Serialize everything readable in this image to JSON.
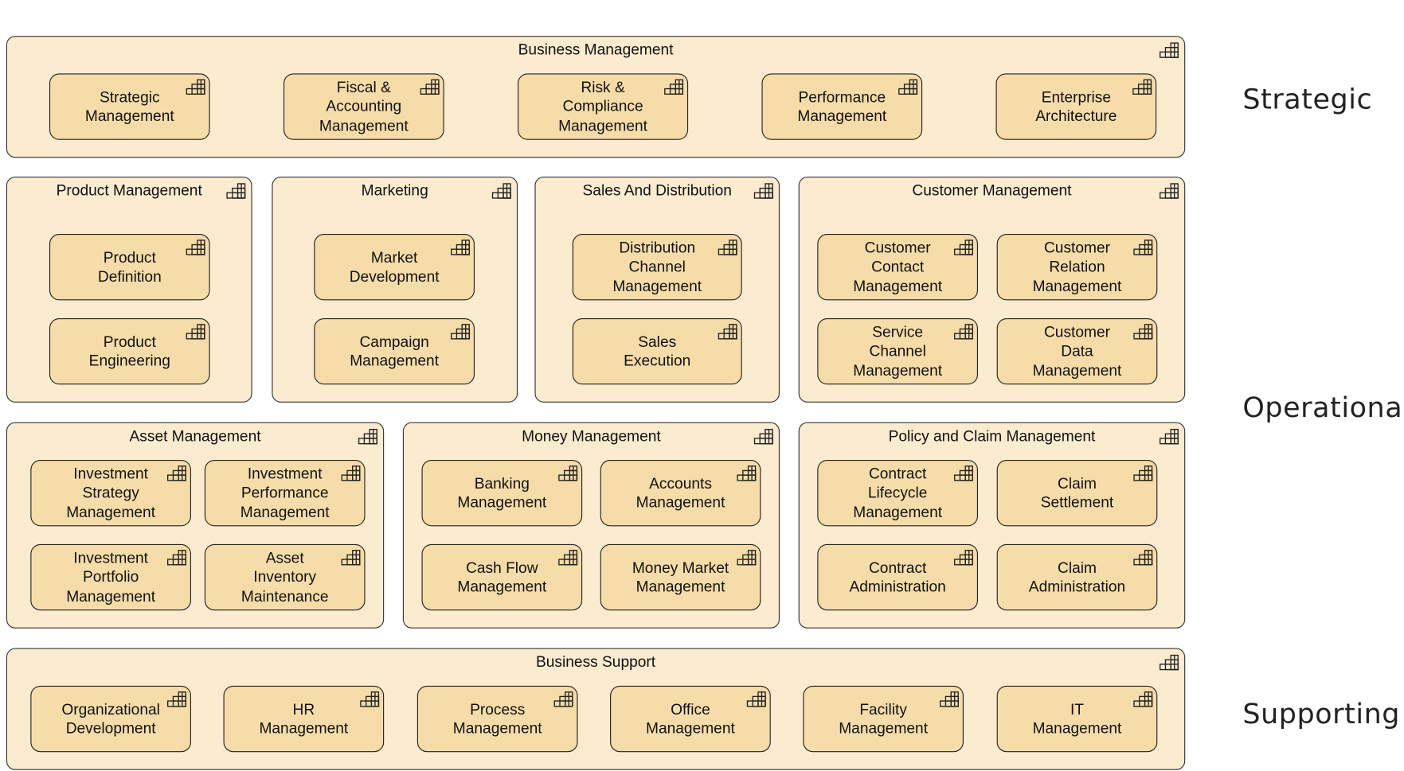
{
  "colors": {
    "group_fill": "#fbebcf",
    "item_fill": "#f6dca8",
    "border": "#333333"
  },
  "icon": "capability-icon",
  "layers": [
    "Strategic",
    "Operational",
    "Supporting"
  ],
  "groups": [
    {
      "title": "Business Management",
      "items": [
        "Strategic\nManagement",
        "Fiscal &\nAccounting\nManagement",
        "Risk &\nCompliance\nManagement",
        "Performance\nManagement",
        "Enterprise\nArchitecture"
      ]
    },
    {
      "title": "Product Management",
      "items": [
        "Product\nDefinition",
        "Product\nEngineering"
      ]
    },
    {
      "title": "Marketing",
      "items": [
        "Market\nDevelopment",
        "Campaign\nManagement"
      ]
    },
    {
      "title": "Sales And Distribution",
      "items": [
        "Distribution\nChannel\nManagement",
        "Sales\nExecution"
      ]
    },
    {
      "title": "Customer Management",
      "items": [
        "Customer\nContact\nManagement",
        "Customer\nRelation\nManagement",
        "Service\nChannel\nManagement",
        "Customer\nData\nManagement"
      ]
    },
    {
      "title": "Asset Management",
      "items": [
        "Investment\nStrategy\nManagement",
        "Investment\nPerformance\nManagement",
        "Investment\nPortfolio\nManagement",
        "Asset\nInventory\nMaintenance"
      ]
    },
    {
      "title": "Money Management",
      "items": [
        "Banking\nManagement",
        "Accounts\nManagement",
        "Cash Flow\nManagement",
        "Money Market\nManagement"
      ]
    },
    {
      "title": "Policy and Claim Management",
      "items": [
        "Contract\nLifecycle\nManagement",
        "Claim\nSettlement",
        "Contract\nAdministration",
        "Claim\nAdministration"
      ]
    },
    {
      "title": "Business Support",
      "items": [
        "Organizational\nDevelopment",
        "HR\nManagement",
        "Process\nManagement",
        "Office\nManagement",
        "Facility\nManagement",
        "IT\nManagement"
      ]
    }
  ]
}
